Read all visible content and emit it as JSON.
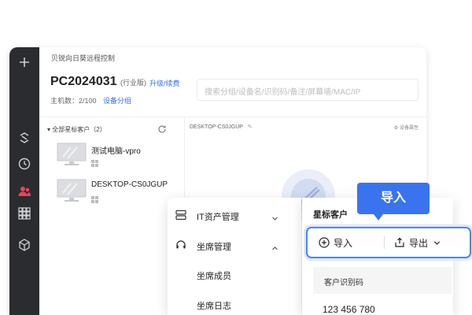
{
  "app": {
    "window_title": "贝锐向日葵远程控制",
    "device_id": "PC2024031",
    "edition": "(行业版)",
    "upgrade_link": "升级/续费",
    "host_count": "主机数：2/100",
    "device_group_link": "设备分组",
    "search_placeholder": "搜索分组/设备名/识别码/备注/屏幕墙/MAC/IP"
  },
  "device_list": {
    "group_label": "全部星标客户（2）",
    "devices": [
      {
        "name": "测试电脑-vpro"
      },
      {
        "name": "DESKTOP-CS0JGUP"
      }
    ]
  },
  "detail": {
    "device_title": "DESKTOP-CS0JGUP",
    "properties_link": "设备属性"
  },
  "menu": {
    "items": [
      {
        "label": "IT资产管理",
        "icon": "server-icon",
        "expanded": false
      },
      {
        "label": "坐席管理",
        "icon": "headset-icon",
        "expanded": true
      }
    ],
    "submenu": [
      "坐席成员",
      "坐席日志"
    ]
  },
  "client_panel": {
    "title": "星标客户",
    "import_label": "导入",
    "export_label": "导出",
    "column_header": "客户识别码",
    "client_id": "123 456 780"
  },
  "tooltip": {
    "text": "导入"
  },
  "colors": {
    "accent": "#3a73ee",
    "link": "#3a6ee8",
    "rail": "#2b2c30",
    "active_icon": "#e8455a"
  }
}
